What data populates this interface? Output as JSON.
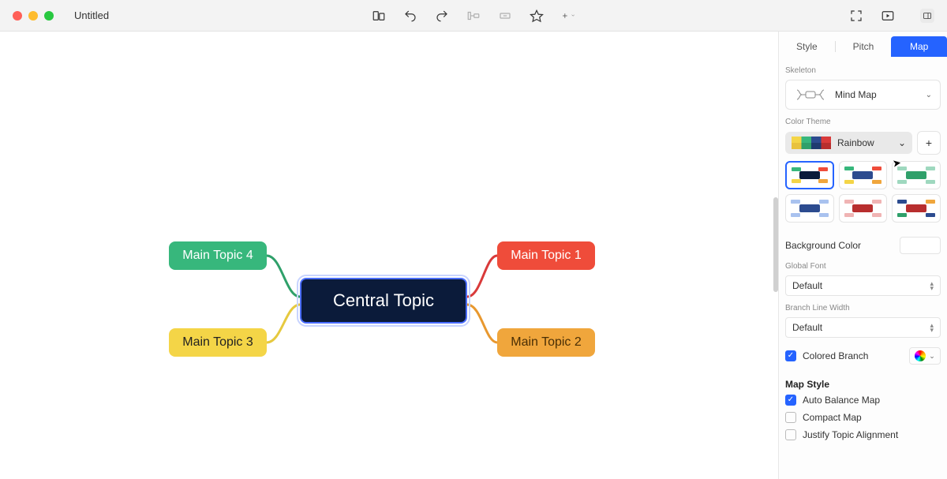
{
  "titlebar": {
    "doc_title": "Untitled"
  },
  "mindmap": {
    "central": "Central Topic",
    "topics": [
      "Main Topic 1",
      "Main Topic 2",
      "Main Topic 3",
      "Main Topic 4"
    ]
  },
  "tabs": {
    "style": "Style",
    "pitch": "Pitch",
    "map": "Map"
  },
  "panel": {
    "skeleton_label": "Skeleton",
    "skeleton_value": "Mind Map",
    "colortheme_label": "Color Theme",
    "colortheme_value": "Rainbow",
    "bgcolor_label": "Background Color",
    "globalfont_label": "Global Font",
    "globalfont_value": "Default",
    "branchwidth_label": "Branch Line Width",
    "branchwidth_value": "Default",
    "colored_branch": "Colored Branch",
    "mapstyle_label": "Map Style",
    "autobalance": "Auto Balance Map",
    "compact": "Compact Map",
    "justify": "Justify Topic Alignment"
  }
}
